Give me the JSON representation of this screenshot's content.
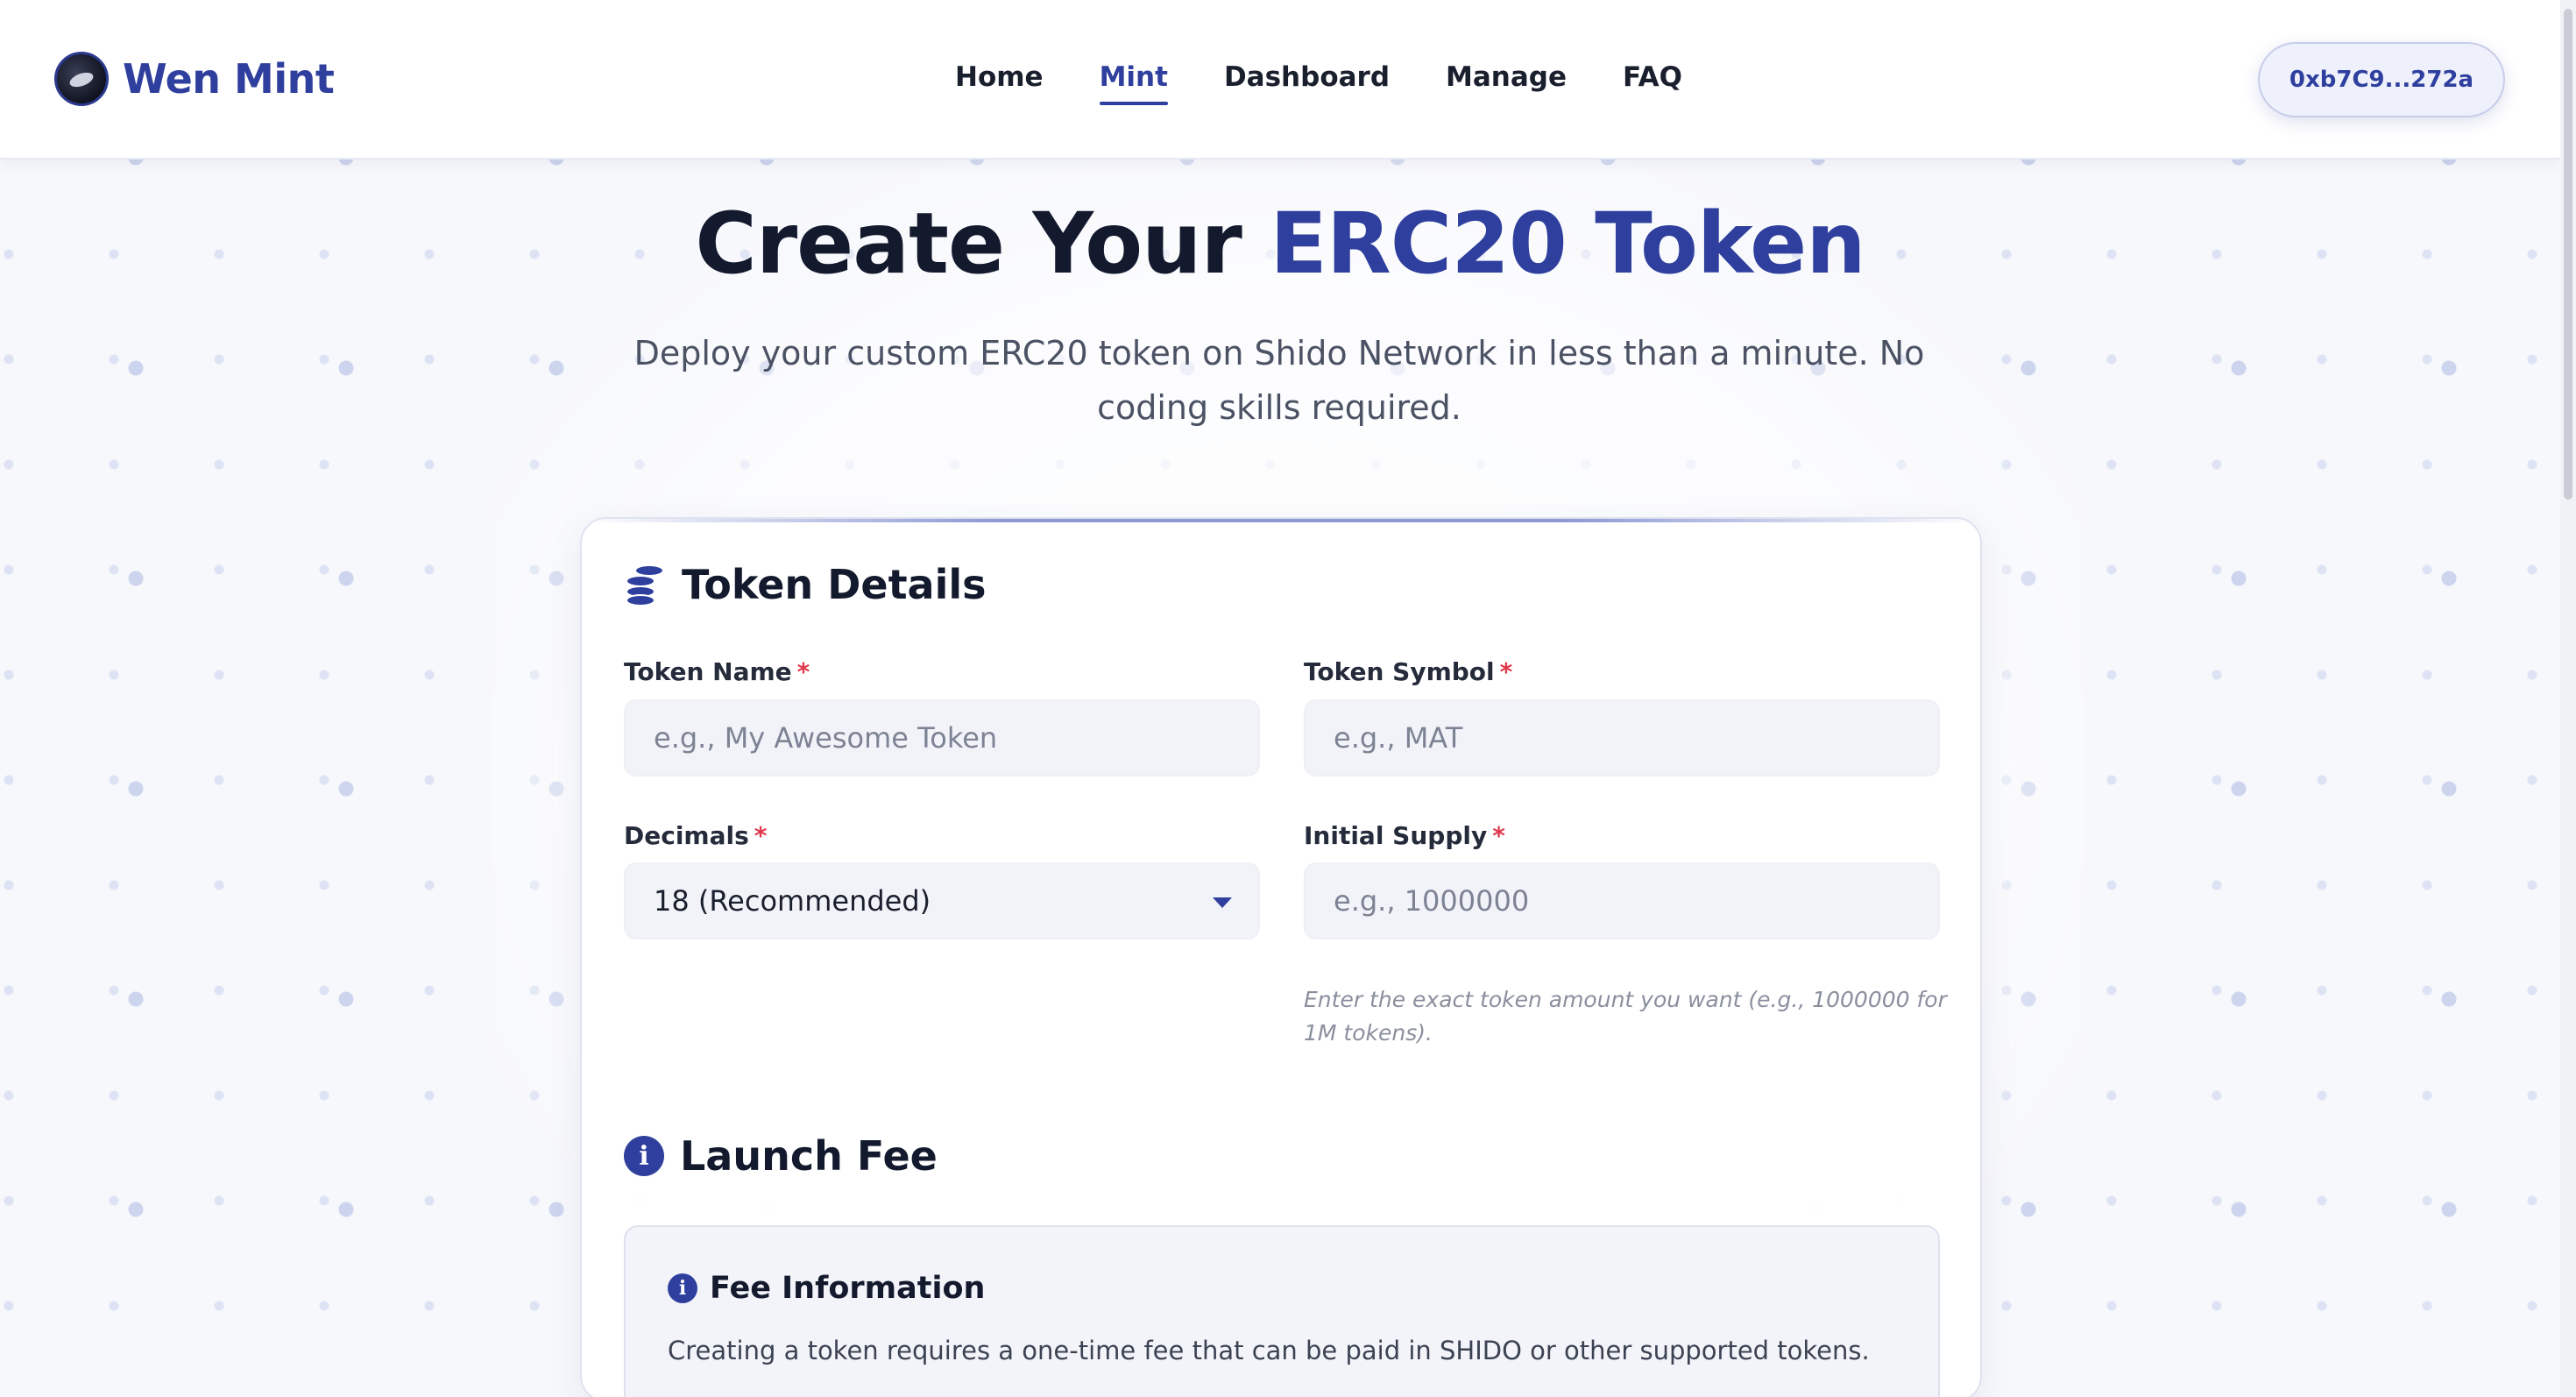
{
  "brand": {
    "name": "Wen Mint"
  },
  "nav": {
    "links": [
      {
        "label": "Home",
        "active": false
      },
      {
        "label": "Mint",
        "active": true
      },
      {
        "label": "Dashboard",
        "active": false
      },
      {
        "label": "Manage",
        "active": false
      },
      {
        "label": "FAQ",
        "active": false
      }
    ]
  },
  "wallet": {
    "address": "0xb7C9...272a"
  },
  "hero": {
    "title_prefix": "Create Your",
    "title_accent": "ERC20 Token",
    "subtitle": "Deploy your custom ERC20 token on Shido Network in less than a minute. No coding skills required."
  },
  "token_details": {
    "title": "Token Details",
    "icon": "coins-icon",
    "required_mark": "*",
    "name": {
      "label": "Token Name",
      "placeholder": "e.g., My Awesome Token"
    },
    "symbol": {
      "label": "Token Symbol",
      "placeholder": "e.g., MAT"
    },
    "decimals": {
      "label": "Decimals",
      "value": "18 (Recommended)"
    },
    "supply": {
      "label": "Initial Supply",
      "placeholder": "e.g., 1000000",
      "hint": "Enter the exact token amount you want (e.g., 1000000 for 1M tokens)."
    }
  },
  "launch_fee": {
    "title": "Launch Fee",
    "icon": "info-icon",
    "info_title": "Fee Information",
    "info_text": "Creating a token requires a one-time fee that can be paid in SHIDO or other supported tokens."
  },
  "colors": {
    "accent": "#2f3f9e",
    "required": "#e0394c",
    "text_dark": "#141a2e"
  }
}
